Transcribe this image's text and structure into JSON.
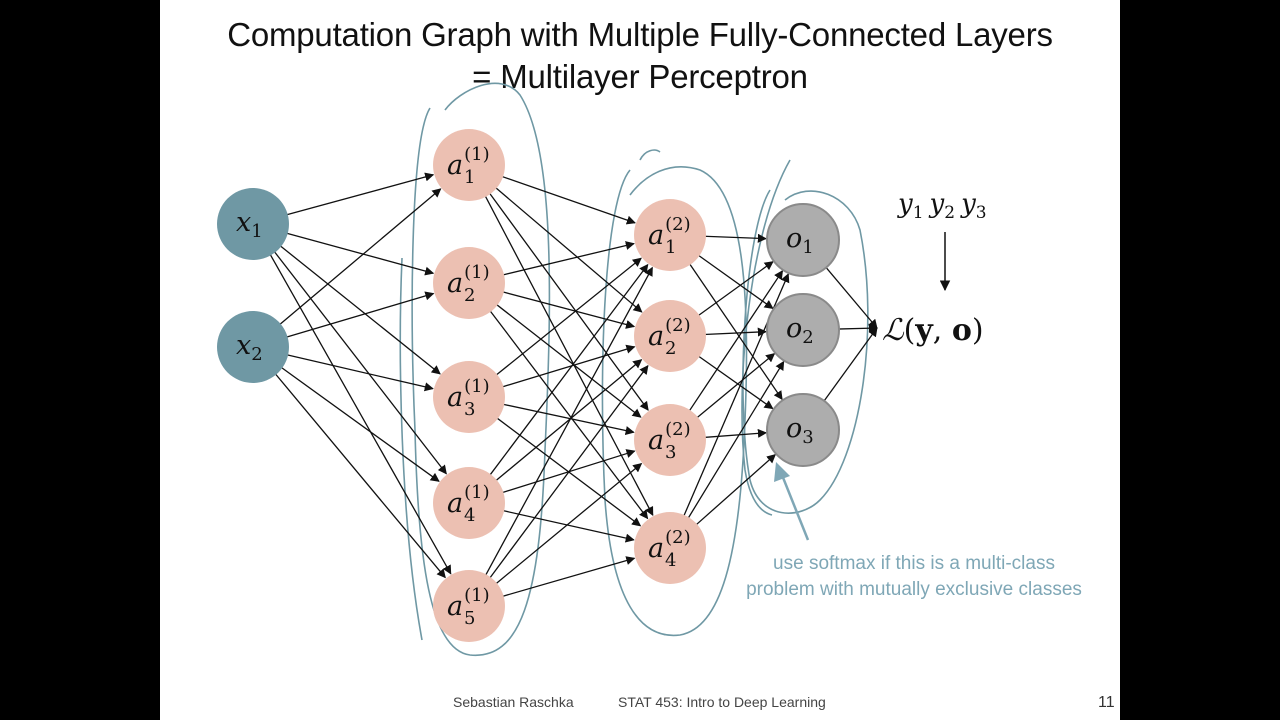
{
  "slide": {
    "title_line1": "Computation Graph with Multiple Fully-Connected Layers",
    "title_line2": "= Multilayer Perceptron",
    "footer_author": "Sebastian Raschka",
    "footer_course": "STAT 453: Intro to Deep Learning",
    "page_number": "11"
  },
  "colors": {
    "input": "#6f98a4",
    "hidden": "#ecc0b2",
    "output": "#adadad",
    "annotation": "#7fa7b6",
    "edge": "#111111"
  },
  "layers": {
    "input": [
      {
        "base": "x",
        "sub": "1"
      },
      {
        "base": "x",
        "sub": "2"
      }
    ],
    "hidden1": [
      {
        "base": "a",
        "sup": "(1)",
        "sub": "1"
      },
      {
        "base": "a",
        "sup": "(1)",
        "sub": "2"
      },
      {
        "base": "a",
        "sup": "(1)",
        "sub": "3"
      },
      {
        "base": "a",
        "sup": "(1)",
        "sub": "4"
      },
      {
        "base": "a",
        "sup": "(1)",
        "sub": "5"
      }
    ],
    "hidden2": [
      {
        "base": "a",
        "sup": "(2)",
        "sub": "1"
      },
      {
        "base": "a",
        "sup": "(2)",
        "sub": "2"
      },
      {
        "base": "a",
        "sup": "(2)",
        "sub": "3"
      },
      {
        "base": "a",
        "sup": "(2)",
        "sub": "4"
      }
    ],
    "output": [
      {
        "base": "o",
        "sub": "1"
      },
      {
        "base": "o",
        "sub": "2"
      },
      {
        "base": "o",
        "sub": "3"
      }
    ]
  },
  "targets": [
    {
      "base": "y",
      "sub": "1"
    },
    {
      "base": "y",
      "sub": "2"
    },
    {
      "base": "y",
      "sub": "3"
    }
  ],
  "loss": {
    "script_l": "ℒ",
    "open": "(",
    "y": "y",
    "comma": ", ",
    "o": "o",
    "close": ")"
  },
  "annotation": {
    "line1": "use softmax if this is a multi-class",
    "line2": "problem with mutually exclusive classes"
  }
}
